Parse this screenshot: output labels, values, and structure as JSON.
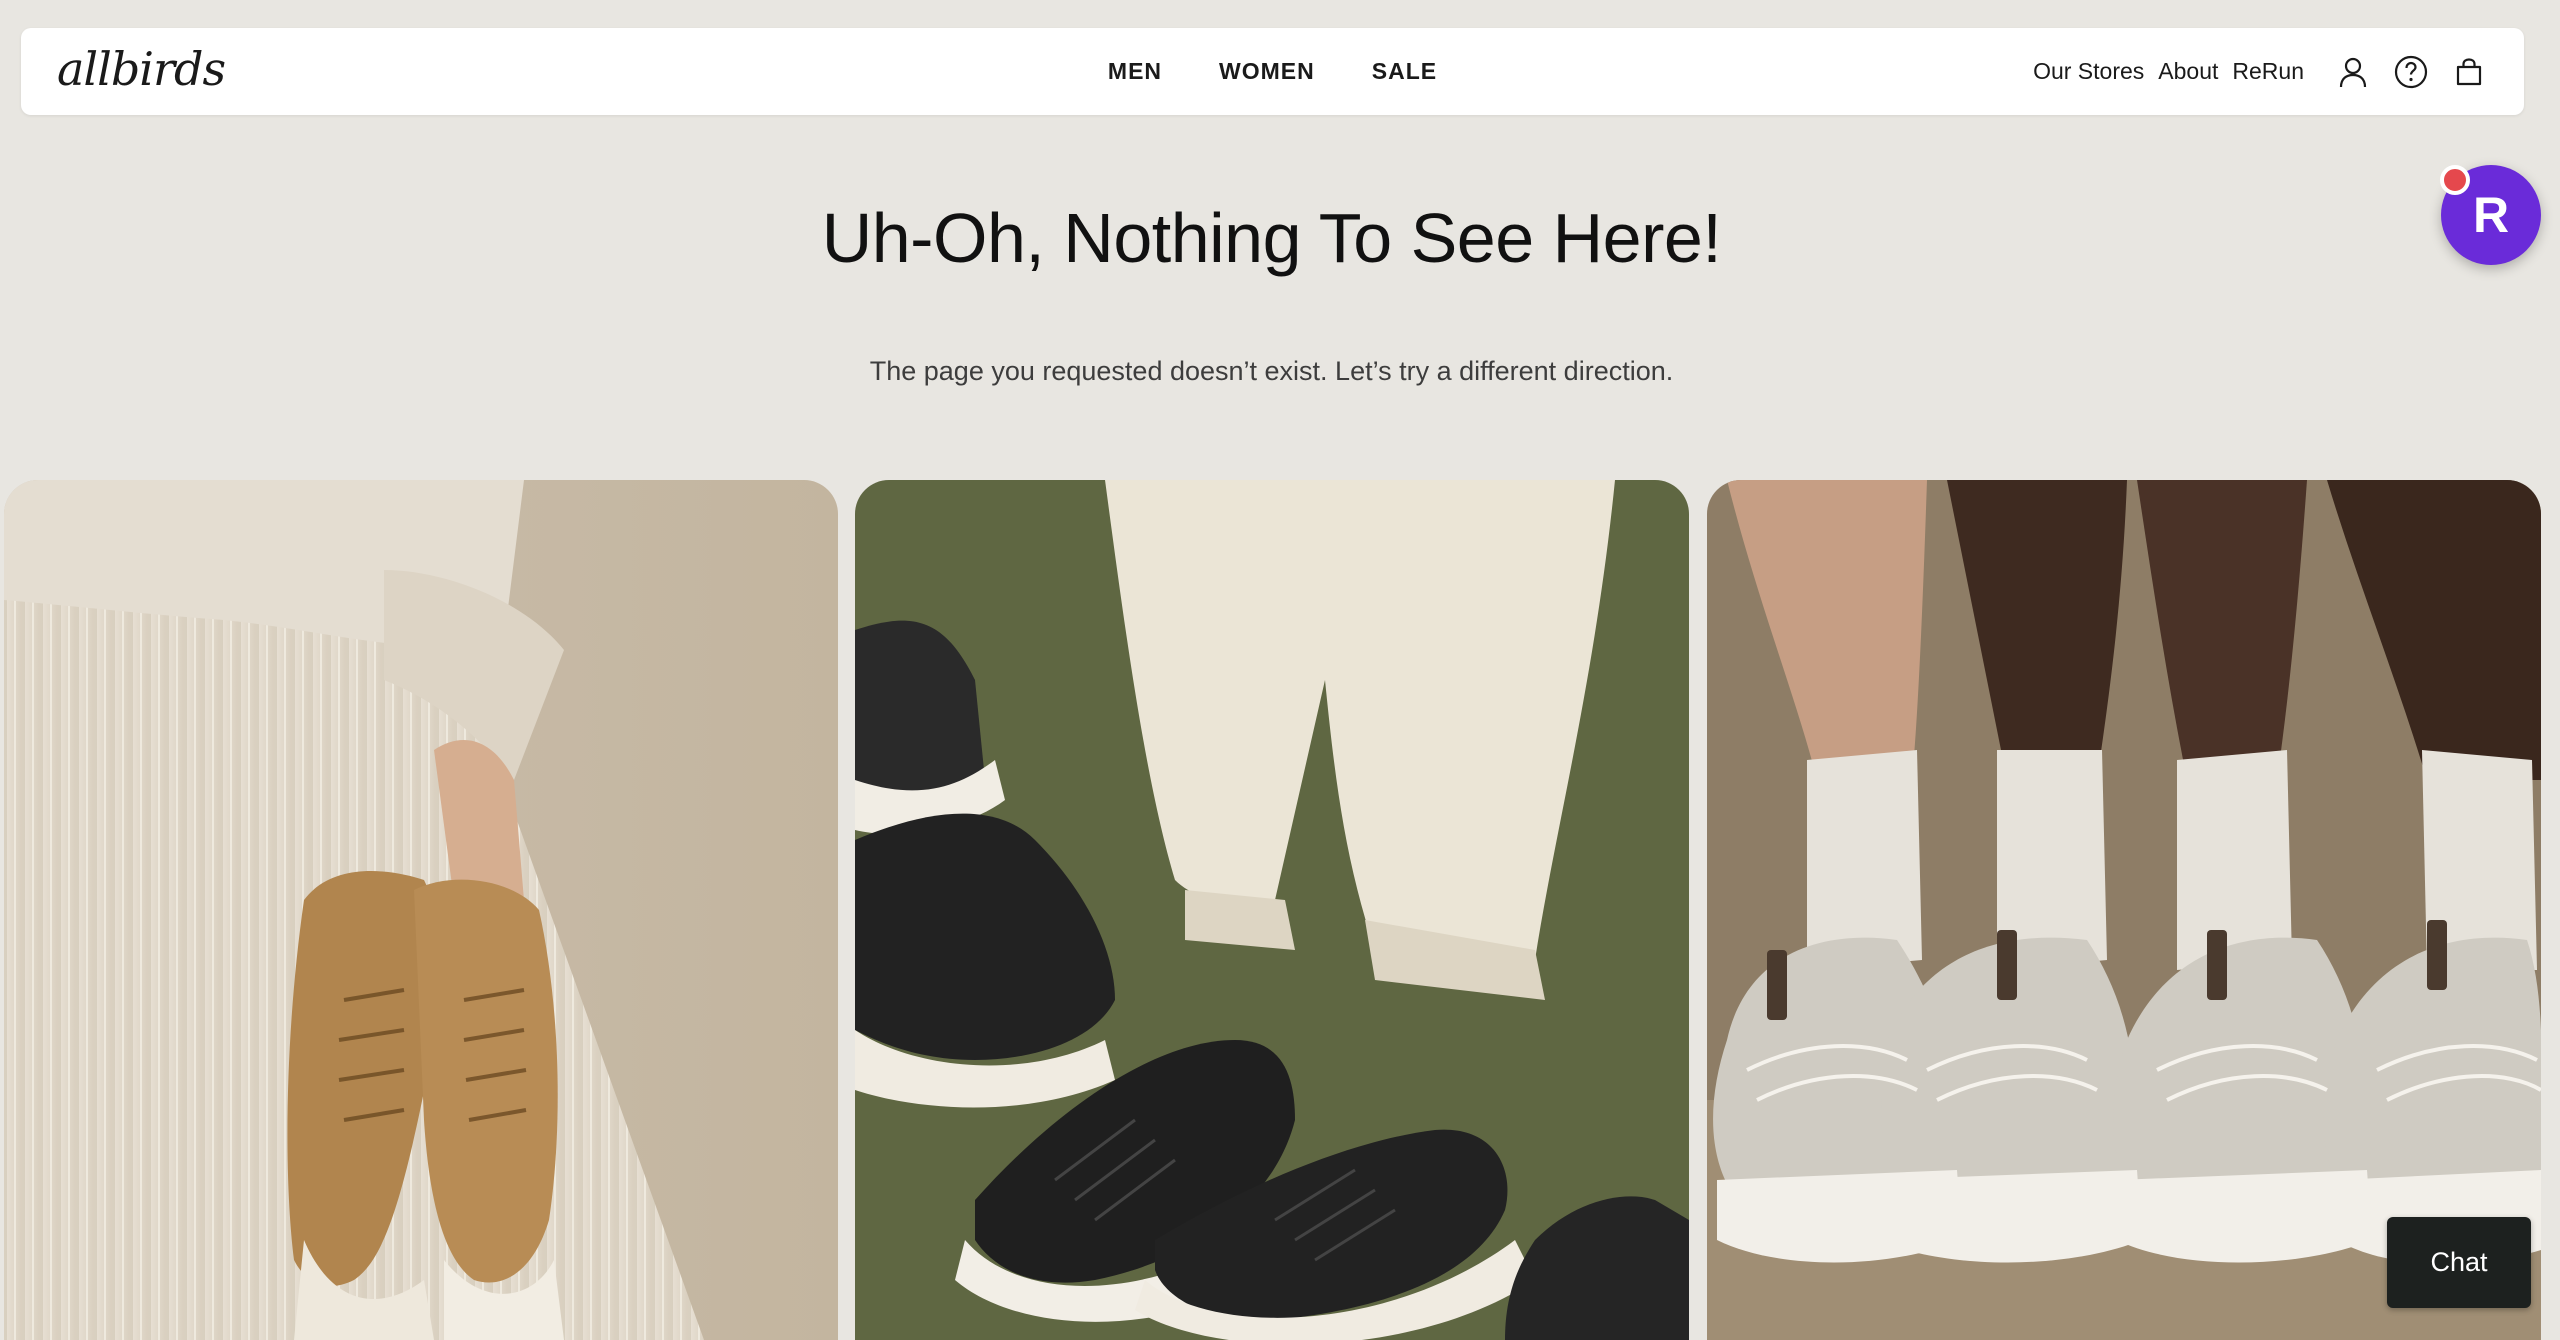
{
  "header": {
    "logo_text": "allbirds",
    "nav": [
      "MEN",
      "WOMEN",
      "SALE"
    ],
    "links": [
      "Our Stores",
      "About",
      "ReRun"
    ],
    "icons": [
      "account-icon",
      "help-icon",
      "cart-icon"
    ]
  },
  "main": {
    "headline": "Uh-Oh, Nothing To See Here!",
    "subtext": "The page you requested doesn’t exist. Let’s try a different direction."
  },
  "images": [
    {
      "name": "woman-holding-tan-sneakers-image"
    },
    {
      "name": "black-sneakers-on-green-image"
    },
    {
      "name": "white-runners-with-socks-image"
    }
  ],
  "floating_badge": {
    "letter": "R",
    "color": "#6a2bd9"
  },
  "chat": {
    "label": "Chat"
  },
  "colors": {
    "background": "#e8e6e1",
    "header_bg": "#ffffff",
    "chat_bg": "#1d211f",
    "badge_dot": "#e5484d"
  }
}
